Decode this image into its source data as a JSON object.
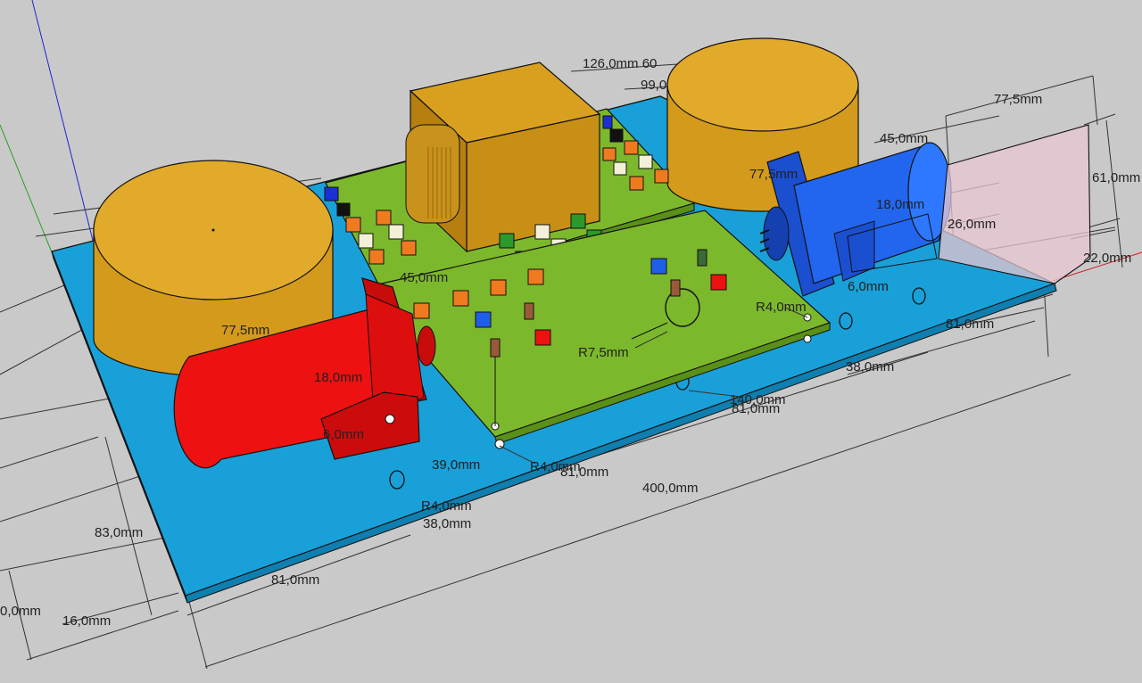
{
  "colors": {
    "background": "#c9c9c9",
    "base_plate": "#1aa0d8",
    "pcb": "#7cb82c",
    "transformer": "#d9a020",
    "capacitor_left": "#ee1111",
    "capacitor_right": "#1f5ee8",
    "end_panel": "#e8c6d0"
  },
  "dimensions": {
    "d126": "126,0mm 60",
    "d99": "99,0",
    "d77_top": "77,5mm",
    "d45_top": "45,0mm",
    "d61": "61,0mm",
    "d18_right": "18,0mm",
    "d26": "26,0mm",
    "d22": "22,0mm",
    "d77_mid": "77,5mm",
    "d45_mid": "45,0mm",
    "d77_left": "77,5mm",
    "d18_left": "18,0mm",
    "d_hole_l": "6,0mm",
    "d_hole_r": "6,0mm",
    "r40_right": "R4,0mm",
    "r75": "R7,5mm",
    "d81_r1": "81,0mm",
    "d38_r": "38,0mm",
    "d140": "140,0mm",
    "d81_mid": "81,0mm",
    "d39": "39,0mm",
    "r40_mid": "R4,0mm",
    "d81_low": "81,0mm",
    "d400": "400,0mm",
    "r40_low": "R4,0mm",
    "d38_l": "38,0mm",
    "d83": "83,0mm",
    "d81_bottom": "81,0mm",
    "d16": "16,0mm",
    "d40_edge": "0,0mm"
  }
}
